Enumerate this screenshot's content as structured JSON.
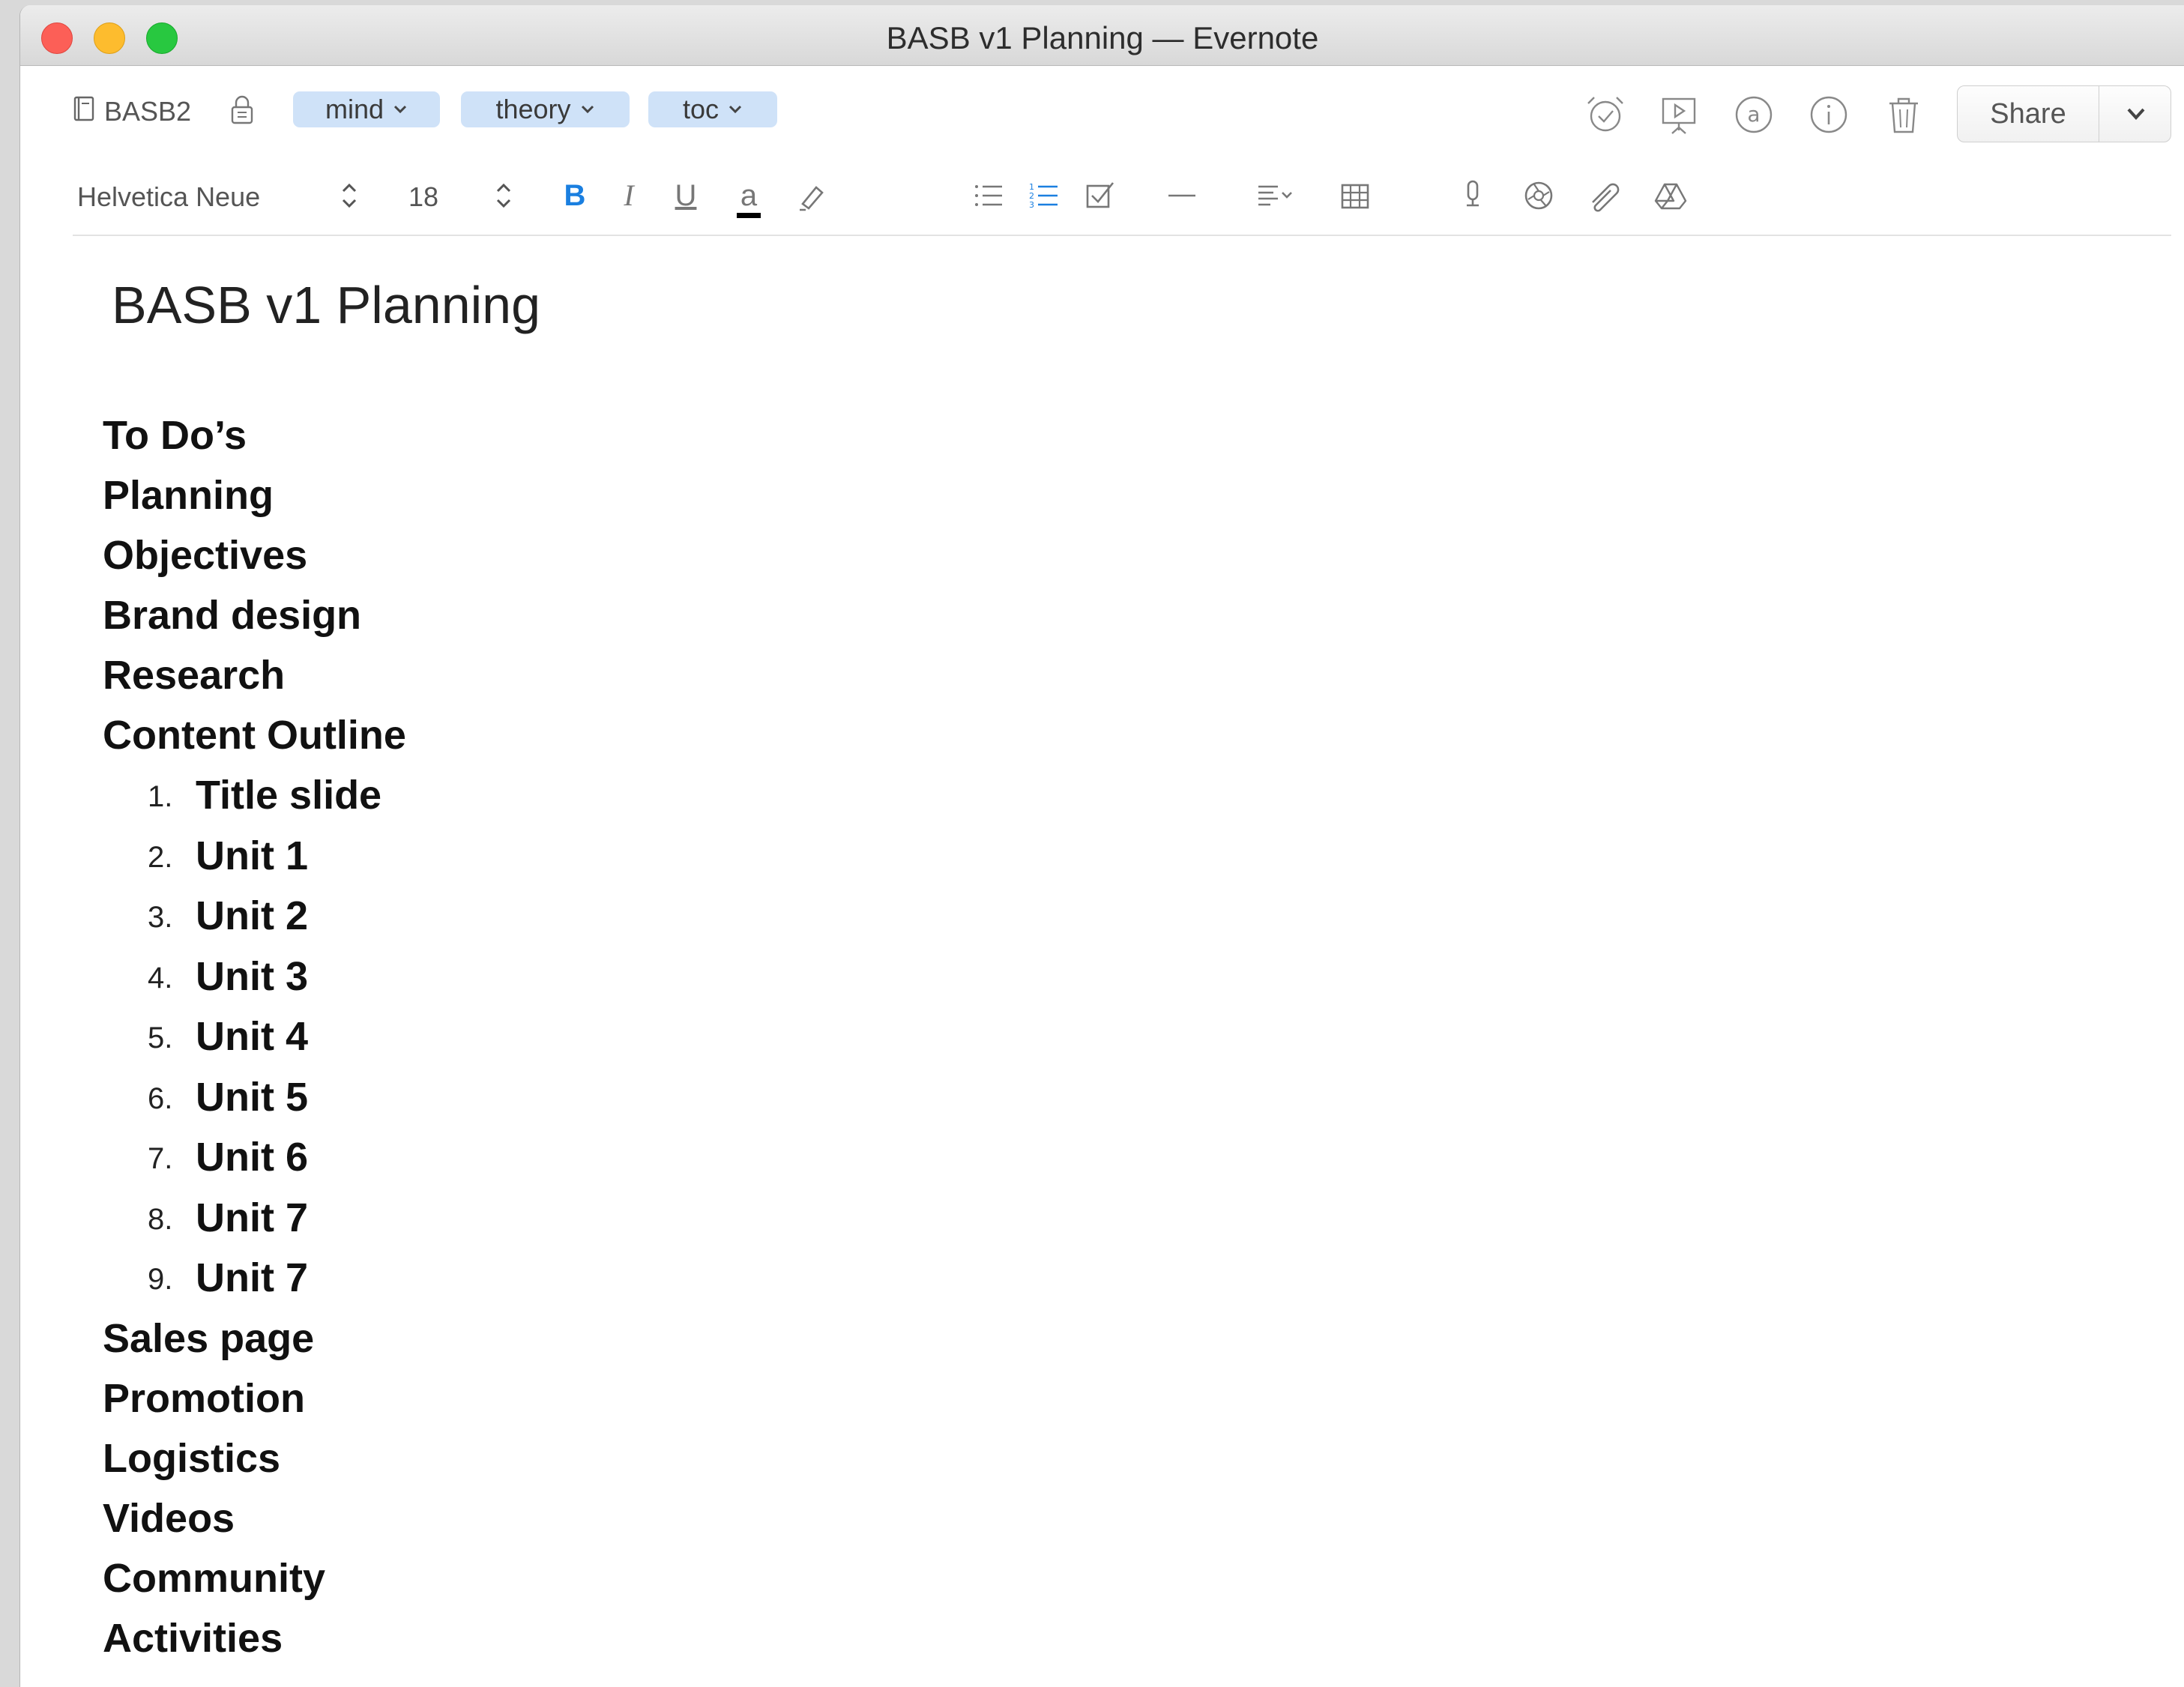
{
  "window": {
    "title": "BASB v1 Planning — Evernote"
  },
  "toolbar": {
    "notebook": "BASB2",
    "tags": [
      {
        "label": "mind"
      },
      {
        "label": "theory"
      },
      {
        "label": "toc"
      }
    ],
    "share_label": "Share",
    "icons": [
      "reminder-icon",
      "presentation-icon",
      "at-mention-icon",
      "info-icon",
      "trash-icon"
    ]
  },
  "format_bar": {
    "font_family": "Helvetica Neue",
    "font_size": "18",
    "bold": "B",
    "italic": "I",
    "underline": "U",
    "font_color": "a",
    "font_color_value": "#000000",
    "active_color": "#1a7fe0"
  },
  "note": {
    "title": "BASB v1 Planning",
    "sections_before": [
      "To Do’s",
      "Planning",
      "Objectives",
      "Brand design",
      "Research",
      "Content Outline"
    ],
    "outline_items": [
      {
        "number": "1.",
        "label": "Title slide"
      },
      {
        "number": "2.",
        "label": "Unit 1"
      },
      {
        "number": "3.",
        "label": "Unit 2"
      },
      {
        "number": "4.",
        "label": "Unit 3"
      },
      {
        "number": "5.",
        "label": "Unit 4"
      },
      {
        "number": "6.",
        "label": "Unit 5"
      },
      {
        "number": "7.",
        "label": "Unit 6"
      },
      {
        "number": "8.",
        "label": "Unit 7"
      },
      {
        "number": "9.",
        "label": "Unit 7"
      }
    ],
    "sections_after": [
      "Sales page",
      "Promotion",
      "Logistics",
      "Videos",
      "Community",
      "Activities"
    ]
  }
}
